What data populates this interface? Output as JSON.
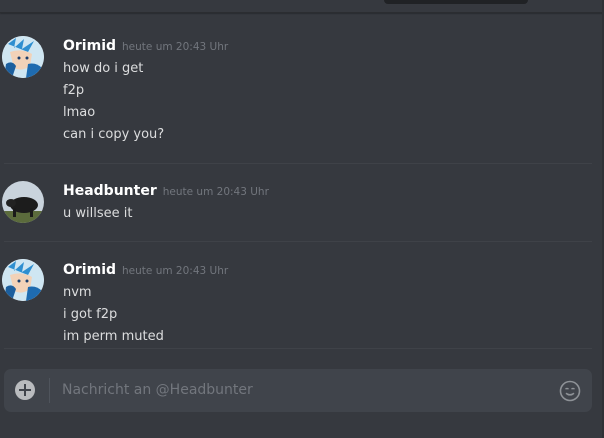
{
  "composer": {
    "placeholder": "Nachricht an @Headbunter"
  },
  "messages": [
    {
      "author": "Orimid",
      "timestamp": "heute um 20:43 Uhr",
      "lines": [
        "how do i get",
        "f2p",
        "lmao",
        "can i copy you?"
      ],
      "avatar": "blue-anime-character-avatar"
    },
    {
      "author": "Headbunter",
      "timestamp": "heute um 20:43 Uhr",
      "lines": [
        "u willsee it"
      ],
      "avatar": "black-bull-avatar"
    },
    {
      "author": "Orimid",
      "timestamp": "heute um 20:43 Uhr",
      "lines": [
        "nvm",
        "i got f2p",
        "im perm muted"
      ],
      "avatar": "blue-anime-character-avatar"
    }
  ],
  "colors": {
    "background": "#36393f",
    "composer": "#40444b",
    "username": "#ffffff",
    "text": "#dcddde",
    "timestamp": "#72767d"
  }
}
